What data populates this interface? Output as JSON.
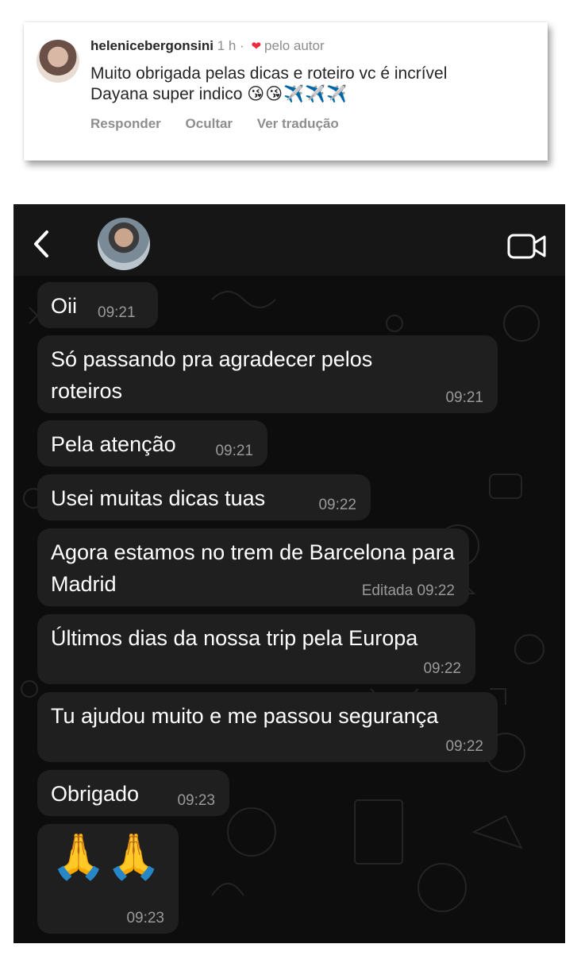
{
  "comment": {
    "username": "helenicebergonsini",
    "time_ago": "1 h",
    "separator": "·",
    "liked_by_author": "pelo autor",
    "text_line1": "Muito obrigada pelas dicas e roteiro vc é incrível",
    "text_line2": "Dayana  super indico",
    "emojis": "😘😘✈️✈️✈️",
    "actions": {
      "reply": "Responder",
      "hide": "Ocultar",
      "translate": "Ver tradução"
    },
    "heart_color": "#ed2d3d"
  },
  "chat": {
    "header": {
      "back_icon": "chevron-left-icon",
      "video_icon": "video-camera-icon"
    },
    "messages": [
      {
        "text": "Oii",
        "time": "09:21"
      },
      {
        "text": "Só passando pra agradecer pelos roteiros",
        "time": "09:21"
      },
      {
        "text": "Pela atenção",
        "time": "09:21"
      },
      {
        "text": "Usei muitas dicas tuas",
        "time": "09:22"
      },
      {
        "text": "Agora estamos no trem de Barcelona para Madrid",
        "time": "Editada 09:22"
      },
      {
        "text": "Últimos dias da nossa trip pela Europa",
        "time": "09:22"
      },
      {
        "text": "Tu ajudou muito e me passou segurança",
        "time": "09:22"
      },
      {
        "text": "Obrigado",
        "time": "09:23"
      },
      {
        "text": "🙏🙏",
        "time": "09:23"
      }
    ],
    "bubble_color": "#1f1f1f",
    "background_color": "#0b0b0b"
  }
}
